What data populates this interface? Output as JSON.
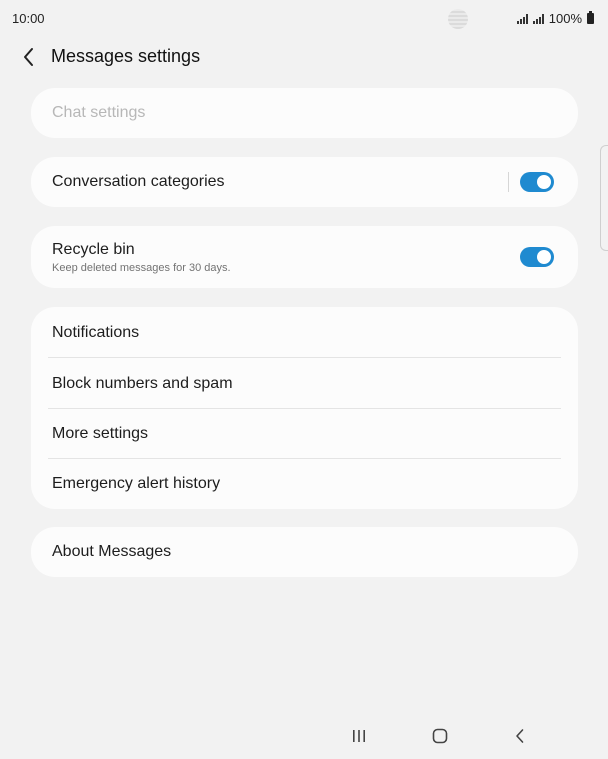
{
  "status_bar": {
    "time": "10:00",
    "battery": "100%",
    "icons": [
      "signal-icon",
      "signal-icon",
      "battery-icon"
    ]
  },
  "header": {
    "back_icon": "back-arrow-icon",
    "title": "Messages settings"
  },
  "cards": {
    "chat": {
      "label": "Chat settings",
      "enabled": false
    },
    "conversation": {
      "label": "Conversation categories",
      "toggle_on": true
    },
    "recycle": {
      "label": "Recycle bin",
      "subtitle": "Keep deleted messages for 30 days.",
      "toggle_on": true
    },
    "group": {
      "items": [
        {
          "label": "Notifications"
        },
        {
          "label": "Block numbers and spam"
        },
        {
          "label": "More settings"
        },
        {
          "label": "Emergency alert history"
        }
      ]
    },
    "about": {
      "label": "About Messages"
    }
  },
  "navbar": {
    "icons": [
      "recent-apps-icon",
      "home-icon",
      "back-icon"
    ]
  },
  "colors": {
    "background": "#f2f2f2",
    "card": "#fcfcfc",
    "accent": "#1f8ad0"
  }
}
